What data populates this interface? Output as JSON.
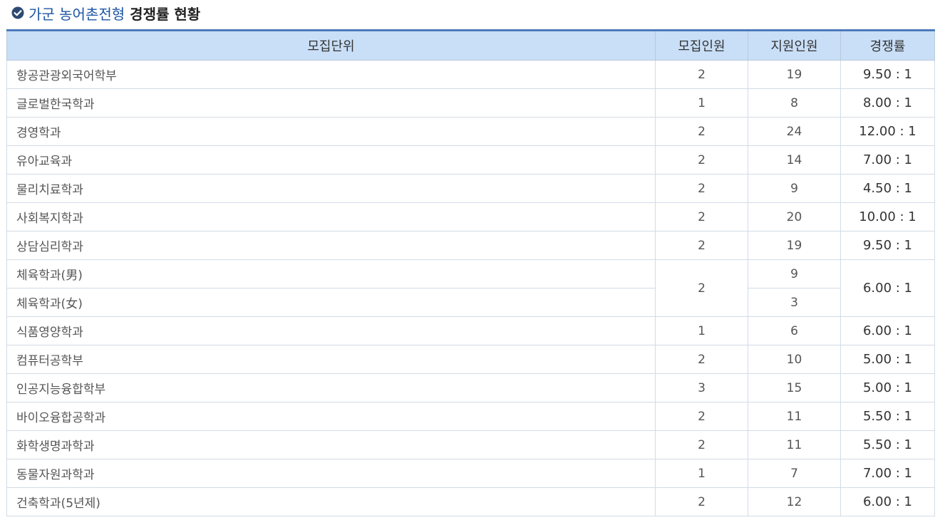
{
  "title": {
    "highlight": "가군 농어촌전형",
    "rest": "경쟁률 현황"
  },
  "icons": {
    "title_icon": "check-circle-icon"
  },
  "colors": {
    "accent": "#1c55a3",
    "header_bg": "#c9dff7",
    "top_border": "#4e7ab8"
  },
  "table": {
    "headers": [
      "모집단위",
      "모집인원",
      "지원인원",
      "경쟁률"
    ],
    "rows": [
      {
        "unit": "항공관광외국어학부",
        "quota": "2",
        "applicants": "19",
        "rate": "9.50 : 1"
      },
      {
        "unit": "글로벌한국학과",
        "quota": "1",
        "applicants": "8",
        "rate": "8.00 : 1"
      },
      {
        "unit": "경영학과",
        "quota": "2",
        "applicants": "24",
        "rate": "12.00 : 1"
      },
      {
        "unit": "유아교육과",
        "quota": "2",
        "applicants": "14",
        "rate": "7.00 : 1"
      },
      {
        "unit": "물리치료학과",
        "quota": "2",
        "applicants": "9",
        "rate": "4.50 : 1"
      },
      {
        "unit": "사회복지학과",
        "quota": "2",
        "applicants": "20",
        "rate": "10.00 : 1"
      },
      {
        "unit": "상담심리학과",
        "quota": "2",
        "applicants": "19",
        "rate": "9.50 : 1"
      },
      {
        "unit": "체육학과(男)",
        "quota": "2",
        "applicants": "9",
        "rate": "6.00 : 1"
      },
      {
        "unit": "체육학과(女)",
        "applicants": "3"
      },
      {
        "unit": "식품영양학과",
        "quota": "1",
        "applicants": "6",
        "rate": "6.00 : 1"
      },
      {
        "unit": "컴퓨터공학부",
        "quota": "2",
        "applicants": "10",
        "rate": "5.00 : 1"
      },
      {
        "unit": "인공지능융합학부",
        "quota": "3",
        "applicants": "15",
        "rate": "5.00 : 1"
      },
      {
        "unit": "바이오융합공학과",
        "quota": "2",
        "applicants": "11",
        "rate": "5.50 : 1"
      },
      {
        "unit": "화학생명과학과",
        "quota": "2",
        "applicants": "11",
        "rate": "5.50 : 1"
      },
      {
        "unit": "동물자원과학과",
        "quota": "1",
        "applicants": "7",
        "rate": "7.00 : 1"
      },
      {
        "unit": "건축학과(5년제)",
        "quota": "2",
        "applicants": "12",
        "rate": "6.00 : 1"
      }
    ]
  }
}
